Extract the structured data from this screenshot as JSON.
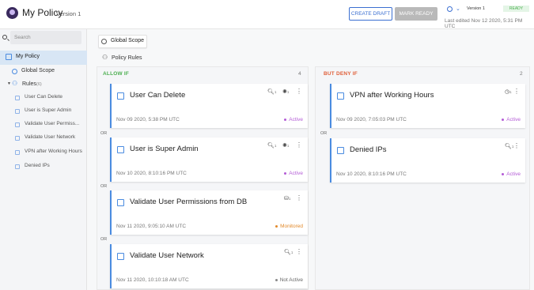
{
  "header": {
    "title": "My Policy",
    "version_label": "Version 1",
    "create_draft": "CREATE DRAFT",
    "mark_ready": "MARK READY",
    "version_select": "Version 1",
    "status": "READY",
    "last_edited": "Last edited Nov 12 2020, 5:31 PM UTC"
  },
  "sidebar": {
    "search_placeholder": "Search",
    "policy": "My Policy",
    "global_scope": "Global Scope",
    "rules_label": "Rules",
    "rules_count": "(6)",
    "rules": [
      "User Can Delete",
      "User is Super Admin",
      "Validate User Permiss...",
      "Validate User Network",
      "VPN after Working Hours",
      "Denied IPs"
    ]
  },
  "main": {
    "scope_chip": "Global Scope",
    "policy_rules": "Policy Rules",
    "allow": {
      "title": "ALLOW IF",
      "count": "4",
      "or": "OR",
      "cards": [
        {
          "title": "User Can Delete",
          "date": "Nov 09 2020, 5:38 PM UTC",
          "status": "Active",
          "icons": [
            "1",
            "1"
          ]
        },
        {
          "title": "User is Super Admin",
          "date": "Nov 10 2020, 8:10:16 PM UTC",
          "status": "Active",
          "icons": [
            "1",
            "1"
          ]
        },
        {
          "title": "Validate User Permissions from DB",
          "date": "Nov 11 2020, 9:05:10 AM UTC",
          "status": "Monitored",
          "icons": [
            "1"
          ]
        },
        {
          "title": "Validate User Network",
          "date": "Nov 11 2020, 10:10:18 AM UTC",
          "status": "Not Active",
          "icons": [
            "1"
          ]
        }
      ]
    },
    "deny": {
      "title": "BUT DENY IF",
      "count": "2",
      "or": "OR",
      "cards": [
        {
          "title": "VPN after Working Hours",
          "date": "Nov 09 2020, 7:05:03 PM UTC",
          "status": "Active",
          "icons": [
            "1"
          ]
        },
        {
          "title": "Denied IPs",
          "date": "Nov 10 2020, 8:10:16 PM UTC",
          "status": "Active",
          "icons": [
            "1"
          ]
        }
      ]
    }
  },
  "colors": {
    "accent": "#3b6fd1",
    "allow": "#4caf50",
    "deny": "#e0603a",
    "active": "#b45cd6",
    "monitored": "#e28a2b",
    "not_active": "#888888"
  }
}
